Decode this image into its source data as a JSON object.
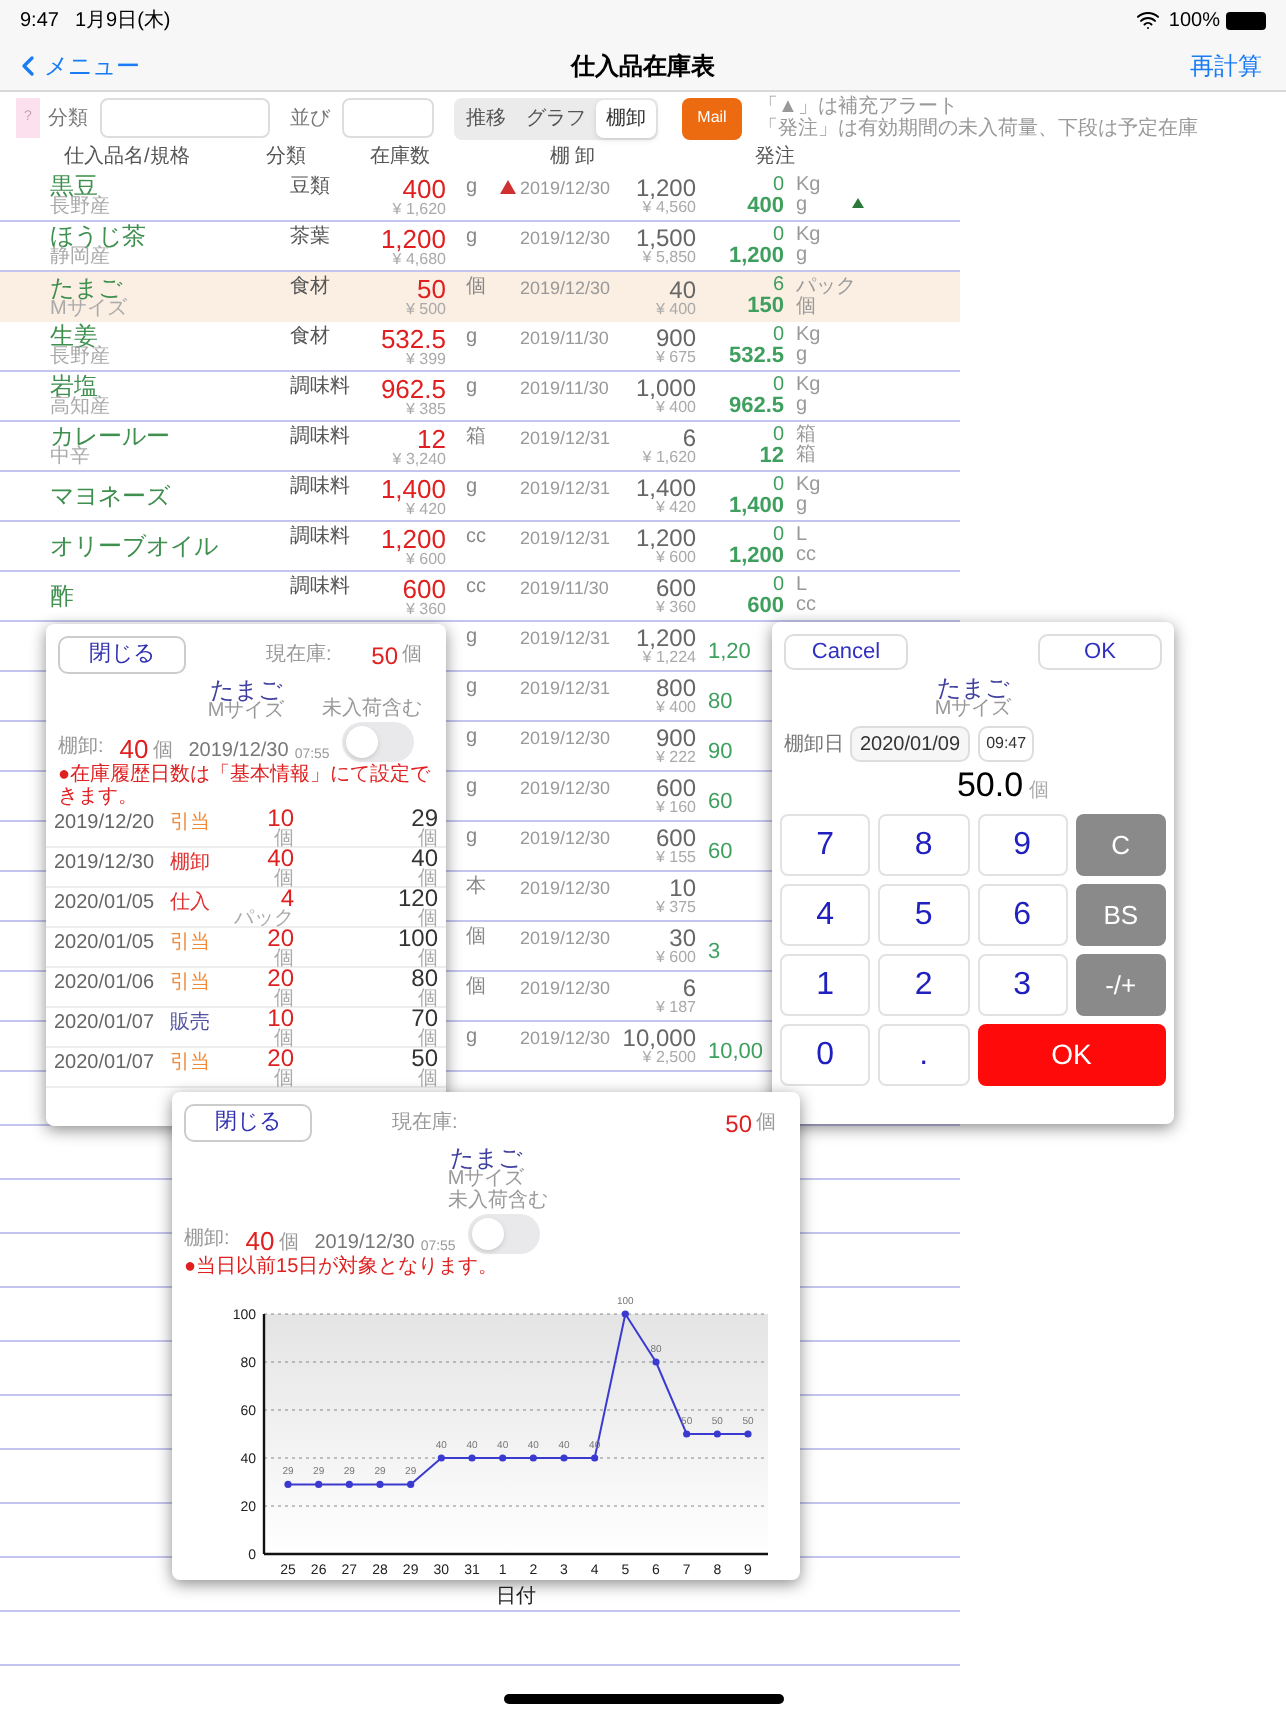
{
  "status_bar": {
    "time": "9:47",
    "date": "1月9日(木)",
    "battery": "100%"
  },
  "nav": {
    "back": "メニュー",
    "title": "仕入品在庫表",
    "action": "再計算"
  },
  "toolbar": {
    "help": "?",
    "category_label": "分類",
    "sort_label": "並び",
    "segments": [
      {
        "label": "推移",
        "selected": false
      },
      {
        "label": "グラフ",
        "selected": false
      },
      {
        "label": "棚卸",
        "selected": true
      }
    ],
    "mail": "Mail",
    "notes": [
      "「▲」は補充アラート",
      "「発注」は有効期間の未入荷量、下段は予定在庫"
    ]
  },
  "table": {
    "columns": [
      "仕入品名/規格",
      "分類",
      "在庫数",
      "棚 卸",
      "発注"
    ],
    "rows": [
      {
        "name": "黒豆",
        "origin": "長野産",
        "category": "豆類",
        "stock": "400",
        "stock_value": "¥ 1,620",
        "unit": "g",
        "alert": true,
        "count_date": "2019/12/30",
        "count": "1,200",
        "count_value": "¥ 4,560",
        "order": "0",
        "order_unit": "Kg",
        "planned": "400",
        "planned_unit": "g",
        "order_alert": true,
        "selected": false
      },
      {
        "name": "ほうじ茶",
        "origin": "静岡産",
        "category": "茶葉",
        "stock": "1,200",
        "stock_value": "¥ 4,680",
        "unit": "g",
        "alert": false,
        "count_date": "2019/12/30",
        "count": "1,500",
        "count_value": "¥ 5,850",
        "order": "0",
        "order_unit": "Kg",
        "planned": "1,200",
        "planned_unit": "g",
        "order_alert": false,
        "selected": false
      },
      {
        "name": "たまご",
        "origin": "Mサイズ",
        "category": "食材",
        "stock": "50",
        "stock_value": "¥ 500",
        "unit": "個",
        "alert": false,
        "count_date": "2019/12/30",
        "count": "40",
        "count_value": "¥ 400",
        "order": "6",
        "order_unit": "パック",
        "planned": "150",
        "planned_unit": "個",
        "order_alert": false,
        "selected": true
      },
      {
        "name": "生姜",
        "origin": "長野産",
        "category": "食材",
        "stock": "532.5",
        "stock_value": "¥ 399",
        "unit": "g",
        "alert": false,
        "count_date": "2019/11/30",
        "count": "900",
        "count_value": "¥ 675",
        "order": "0",
        "order_unit": "Kg",
        "planned": "532.5",
        "planned_unit": "g",
        "order_alert": false,
        "selected": false
      },
      {
        "name": "岩塩",
        "origin": "高知産",
        "category": "調味料",
        "stock": "962.5",
        "stock_value": "¥ 385",
        "unit": "g",
        "alert": false,
        "count_date": "2019/11/30",
        "count": "1,000",
        "count_value": "¥ 400",
        "order": "0",
        "order_unit": "Kg",
        "planned": "962.5",
        "planned_unit": "g",
        "order_alert": false,
        "selected": false
      },
      {
        "name": "カレールー",
        "origin": "中辛",
        "category": "調味料",
        "stock": "12",
        "stock_value": "¥ 3,240",
        "unit": "箱",
        "alert": false,
        "count_date": "2019/12/31",
        "count": "6",
        "count_value": "¥ 1,620",
        "order": "0",
        "order_unit": "箱",
        "planned": "12",
        "planned_unit": "箱",
        "order_alert": false,
        "selected": false
      },
      {
        "name": "マヨネーズ",
        "category": "調味料",
        "stock": "1,400",
        "stock_value": "¥ 420",
        "unit": "g",
        "alert": false,
        "count_date": "2019/12/31",
        "count": "1,400",
        "count_value": "¥ 420",
        "order": "0",
        "order_unit": "Kg",
        "planned": "1,400",
        "planned_unit": "g",
        "order_alert": false,
        "selected": false
      },
      {
        "name": "オリーブオイル",
        "category": "調味料",
        "stock": "1,200",
        "stock_value": "¥ 600",
        "unit": "cc",
        "alert": false,
        "count_date": "2019/12/31",
        "count": "1,200",
        "count_value": "¥ 600",
        "order": "0",
        "order_unit": "L",
        "planned": "1,200",
        "planned_unit": "cc",
        "order_alert": false,
        "selected": false
      },
      {
        "name": "酢",
        "category": "調味料",
        "stock": "600",
        "stock_value": "¥ 360",
        "unit": "cc",
        "alert": false,
        "count_date": "2019/11/30",
        "count": "600",
        "count_value": "¥ 360",
        "order": "0",
        "order_unit": "L",
        "planned": "600",
        "planned_unit": "cc",
        "order_alert": false,
        "selected": false
      }
    ],
    "partial_rows": [
      {
        "unit": "g",
        "count_date": "2019/12/31",
        "count": "1,200",
        "count_value": "¥ 1,224",
        "planned": "1,20"
      },
      {
        "unit": "g",
        "count_date": "2019/12/31",
        "count": "800",
        "count_value": "¥ 400",
        "planned": "80"
      },
      {
        "unit": "g",
        "count_date": "2019/12/30",
        "count": "900",
        "count_value": "¥ 222",
        "planned": "90"
      },
      {
        "unit": "g",
        "count_date": "2019/12/30",
        "count": "600",
        "count_value": "¥ 160",
        "planned": "60"
      },
      {
        "unit": "g",
        "count_date": "2019/12/30",
        "count": "600",
        "count_value": "¥ 155",
        "planned": "60"
      },
      {
        "unit": "本",
        "count_date": "2019/12/30",
        "count": "10",
        "count_value": "¥ 375"
      },
      {
        "unit": "個",
        "count_date": "2019/12/30",
        "count": "30",
        "count_value": "¥ 600",
        "planned": "3"
      },
      {
        "unit": "個",
        "count_date": "2019/12/30",
        "count": "6",
        "count_value": "¥ 187"
      },
      {
        "unit": "g",
        "count_date": "2019/12/30",
        "count": "10,000",
        "count_value": "¥ 2,500",
        "planned": "10,00"
      }
    ]
  },
  "history_panel": {
    "close": "閉じる",
    "stock_label": "現在庫:",
    "stock": "50",
    "stock_unit": "個",
    "item": "たまご",
    "spec": "Mサイズ",
    "count_label": "棚卸:",
    "count": "40",
    "count_unit": "個",
    "count_date": "2019/12/30",
    "count_time": "07:55",
    "toggle": {
      "label": "未入荷含む",
      "on": false
    },
    "note": "●在庫履歴日数は「基本情報」にて設定できます。",
    "entries": [
      {
        "date": "2019/12/20",
        "type": "引当",
        "color": "#f08a3a",
        "qty": "10",
        "qty_unit": "個",
        "balance": "29",
        "balance_unit": "個"
      },
      {
        "date": "2019/12/30",
        "type": "棚卸",
        "color": "#e03030",
        "qty": "40",
        "qty_unit": "個",
        "balance": "40",
        "balance_unit": "個"
      },
      {
        "date": "2020/01/05",
        "type": "仕入",
        "color": "#e03030",
        "qty": "4",
        "qty_unit": "パック",
        "balance": "120",
        "balance_unit": "個"
      },
      {
        "date": "2020/01/05",
        "type": "引当",
        "color": "#f08a3a",
        "qty": "20",
        "qty_unit": "個",
        "balance": "100",
        "balance_unit": "個"
      },
      {
        "date": "2020/01/06",
        "type": "引当",
        "color": "#f08a3a",
        "qty": "20",
        "qty_unit": "個",
        "balance": "80",
        "balance_unit": "個"
      },
      {
        "date": "2020/01/07",
        "type": "販売",
        "color": "#5050a0",
        "qty": "10",
        "qty_unit": "個",
        "balance": "70",
        "balance_unit": "個"
      },
      {
        "date": "2020/01/07",
        "type": "引当",
        "color": "#f08a3a",
        "qty": "20",
        "qty_unit": "個",
        "balance": "50",
        "balance_unit": "個"
      }
    ]
  },
  "keypad_panel": {
    "cancel": "Cancel",
    "ok": "OK",
    "item": "たまご",
    "spec": "Mサイズ",
    "date_label": "棚卸日",
    "date": "2020/01/09",
    "time": "09:47",
    "value": "50.0",
    "unit": "個",
    "keys": [
      {
        "label": "7",
        "kind": "digit"
      },
      {
        "label": "8",
        "kind": "digit"
      },
      {
        "label": "9",
        "kind": "digit"
      },
      {
        "label": "C",
        "kind": "func"
      },
      {
        "label": "4",
        "kind": "digit"
      },
      {
        "label": "5",
        "kind": "digit"
      },
      {
        "label": "6",
        "kind": "digit"
      },
      {
        "label": "BS",
        "kind": "func"
      },
      {
        "label": "1",
        "kind": "digit"
      },
      {
        "label": "2",
        "kind": "digit"
      },
      {
        "label": "3",
        "kind": "digit"
      },
      {
        "label": "-/+",
        "kind": "func"
      },
      {
        "label": "0",
        "kind": "digit"
      },
      {
        "label": ".",
        "kind": "digit"
      },
      {
        "label": "OK",
        "kind": "ok"
      }
    ]
  },
  "chart_panel": {
    "close": "閉じる",
    "stock_label": "現在庫:",
    "stock": "50",
    "stock_unit": "個",
    "item": "たまご",
    "spec": "Mサイズ",
    "count_label": "棚卸:",
    "count": "40",
    "count_unit": "個",
    "count_date": "2019/12/30",
    "count_time": "07:55",
    "toggle": {
      "label": "未入荷含む",
      "on": false
    },
    "note": "●当日以前15日が対象となります。",
    "chart_data": {
      "type": "line",
      "xlabel": "日付",
      "categories": [
        "25",
        "26",
        "27",
        "28",
        "29",
        "30",
        "31",
        "1",
        "2",
        "3",
        "4",
        "5",
        "6",
        "7",
        "8",
        "9"
      ],
      "series": [
        {
          "color": "#3a3ad0",
          "marker": "circle",
          "values": [
            29,
            29,
            29,
            29,
            29,
            40,
            40,
            40,
            40,
            40,
            40,
            100,
            80,
            50,
            50,
            50
          ]
        }
      ],
      "ylim": [
        0,
        100
      ],
      "yticks": [
        0,
        20,
        40,
        60,
        80,
        100
      ],
      "grid": true,
      "data_labels": true
    }
  }
}
